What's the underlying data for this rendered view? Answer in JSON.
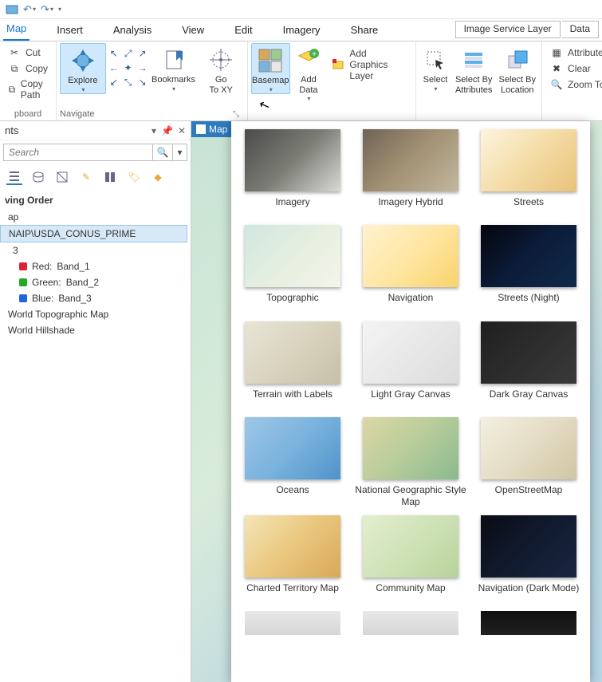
{
  "qat": {
    "save": "",
    "undo": "",
    "redo": ""
  },
  "tabs": {
    "items": [
      {
        "label": "Map",
        "active": true
      },
      {
        "label": "Insert"
      },
      {
        "label": "Analysis"
      },
      {
        "label": "View"
      },
      {
        "label": "Edit"
      },
      {
        "label": "Imagery"
      },
      {
        "label": "Share"
      }
    ],
    "context_combo": "Image Service Layer",
    "context_btn": "Data"
  },
  "clipboard": {
    "group_label": "pboard",
    "cut": "Cut",
    "copy": "Copy",
    "copy_path": "Copy Path"
  },
  "navigate": {
    "group_label": "Navigate",
    "explore": "Explore",
    "bookmarks": "Bookmarks",
    "goto": "Go\nTo XY"
  },
  "layer": {
    "basemap": "Basemap",
    "add_data": "Add\nData",
    "add_graphics": "Add Graphics Layer"
  },
  "selection": {
    "select": "Select",
    "by_attr": "Select By\nAttributes",
    "by_loc": "Select By\nLocation"
  },
  "inquiry": {
    "attributes": "Attributes",
    "clear": "Clear",
    "zoom_to": "Zoom To"
  },
  "panel": {
    "title": "nts",
    "search_placeholder": "Search",
    "drawing_order": "ving Order",
    "map": "ap",
    "layer": "NAIP\\USDA_CONUS_PRIME",
    "rgb_heading": "3",
    "bands": [
      {
        "color": "#d23",
        "label": "Red:",
        "value": "Band_1"
      },
      {
        "color": "#2a2",
        "label": "Green:",
        "value": "Band_2"
      },
      {
        "color": "#26d",
        "label": "Blue:",
        "value": "Band_3"
      }
    ],
    "world_topo": "World Topographic Map",
    "world_hill": "World Hillshade"
  },
  "maptab": {
    "label": "Map"
  },
  "basemap_gallery": {
    "items": [
      {
        "label": "Imagery",
        "bg": "linear-gradient(135deg,#4b4b4b,#7a7c74,#d8d9d3)"
      },
      {
        "label": "Imagery Hybrid",
        "bg": "linear-gradient(135deg,#6f6356,#a39274,#c2b79f)"
      },
      {
        "label": "Streets",
        "bg": "linear-gradient(135deg,#fdf4df,#f4dca6,#e8c27a)"
      },
      {
        "label": "Topographic",
        "bg": "linear-gradient(135deg,#cfe7e0,#e5efe0,#f4f5ea)"
      },
      {
        "label": "Navigation",
        "bg": "linear-gradient(135deg,#fff2cf,#ffe6a3,#f8d36b)"
      },
      {
        "label": "Streets (Night)",
        "bg": "linear-gradient(135deg,#05060d,#0c1c3a,#102a4a)"
      },
      {
        "label": "Terrain with Labels",
        "bg": "linear-gradient(135deg,#e8e5d6,#d9d3bf,#c7c0a7)"
      },
      {
        "label": "Light Gray Canvas",
        "bg": "linear-gradient(135deg,#f4f4f4,#e8e8e8,#dcdcdc)"
      },
      {
        "label": "Dark Gray Canvas",
        "bg": "linear-gradient(135deg,#1f1f1f,#2d2d2d,#3a3a3a)"
      },
      {
        "label": "Oceans",
        "bg": "linear-gradient(135deg,#9fc7e6,#7ab3dd,#4f93cb)"
      },
      {
        "label": "National Geographic Style Map",
        "bg": "linear-gradient(135deg,#dcd7a6,#b7cc9a,#8bb98f)"
      },
      {
        "label": "OpenStreetMap",
        "bg": "linear-gradient(135deg,#f4efe1,#e4dcc4,#d0c6a4)"
      },
      {
        "label": "Charted Territory Map",
        "bg": "linear-gradient(135deg,#f5e5b6,#e9c77e,#d9a75a)"
      },
      {
        "label": "Community Map",
        "bg": "linear-gradient(135deg,#e4eecf,#cfe2b7,#b8d39b)"
      },
      {
        "label": "Navigation (Dark Mode)",
        "bg": "linear-gradient(135deg,#0a0c14,#111a2e,#1a2641)"
      }
    ],
    "peek": [
      {
        "bg": "linear-gradient(#e8e8e8,#d6d6d6)"
      },
      {
        "bg": "linear-gradient(#e8e8e8,#d6d6d6)"
      },
      {
        "bg": "linear-gradient(#101010,#202020)"
      }
    ]
  }
}
